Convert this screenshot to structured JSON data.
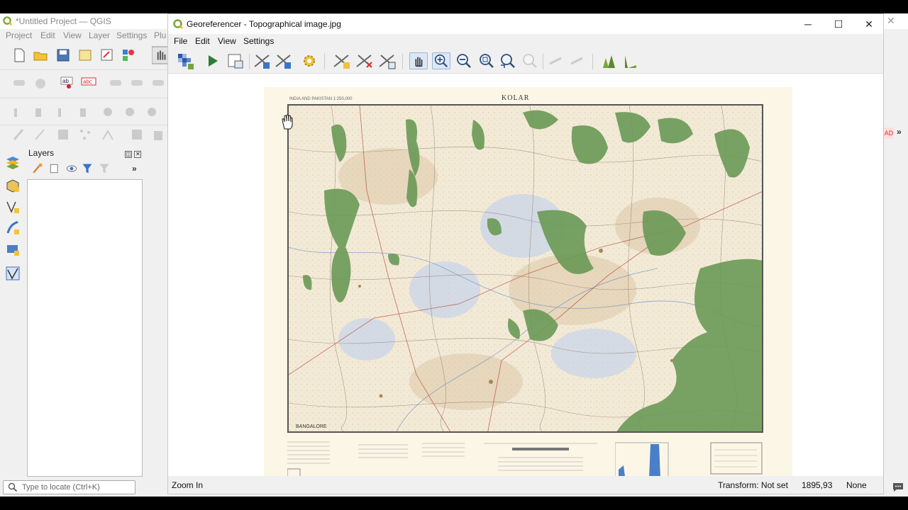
{
  "qgis": {
    "title": "*Untitled Project — QGIS",
    "menu": [
      "Project",
      "Edit",
      "View",
      "Layer",
      "Settings",
      "Plu"
    ],
    "layers_panel_title": "Layers",
    "locator_placeholder": "Type to locate (Ctrl+K)",
    "right_badge": "AD"
  },
  "georeferencer": {
    "title": "Georeferencer - Topographical image.jpg",
    "menu": [
      "File",
      "Edit",
      "View",
      "Settings"
    ],
    "toolbar_icons": [
      "open-raster-icon",
      "start-georeferencing-icon",
      "generate-gdal-script-icon",
      "load-gcp-points-icon",
      "save-gcp-points-icon",
      "transformation-settings-icon",
      "add-point-icon",
      "delete-point-icon",
      "move-gcp-point-icon",
      "pan-icon",
      "zoom-in-icon",
      "zoom-out-icon",
      "zoom-to-layer-icon",
      "zoom-last-icon",
      "zoom-next-icon",
      "link-georeferencer-to-qgis-icon",
      "link-qgis-to-georeferencer-icon",
      "full-histogram-stretch-icon",
      "local-histogram-stretch-icon"
    ],
    "map": {
      "sheet_title": "KOLAR",
      "top_left_caption": "INDIA AND PAKISTAN 1:250,000",
      "footer_place": "BANGALORE"
    },
    "status": {
      "tool": "Zoom In",
      "transform": "Transform: Not set",
      "coords": "1895,93",
      "crs": "None"
    }
  },
  "colors": {
    "forest": "#6a9a56",
    "map_paper": "#f3ead6",
    "qgis_green": "#7aa33a"
  }
}
